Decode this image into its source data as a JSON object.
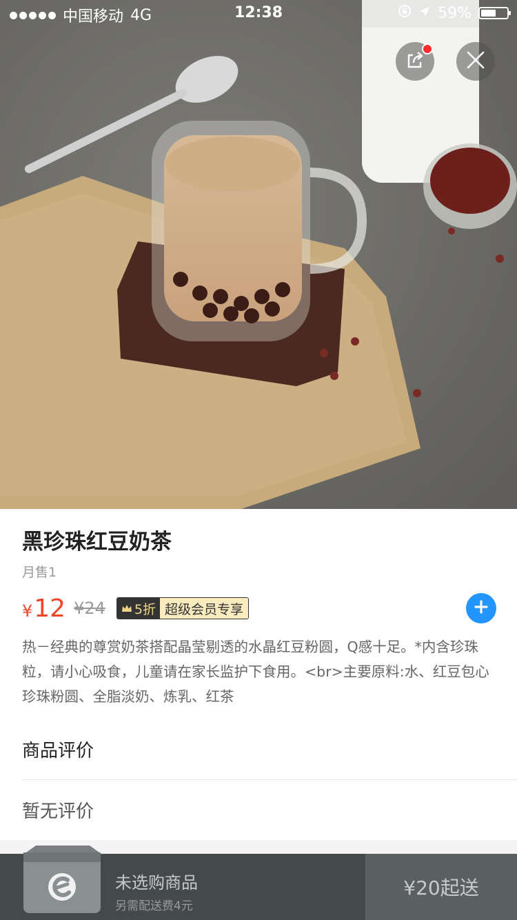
{
  "status_bar": {
    "carrier": "中国移动",
    "network": "4G",
    "time": "12:38",
    "battery": "59%",
    "battery_level": 0.59
  },
  "product": {
    "name": "黑珍珠红豆奶茶",
    "monthly_sales": "月售1",
    "currency": "¥",
    "price": "12",
    "original_price": "¥24",
    "discount": "5折",
    "member_label": "超级会员专享",
    "description": "热－经典的尊赏奶茶搭配晶莹剔透的水晶红豆粉圆，Q感十足。*内含珍珠粒，请小心吸食，儿童请在家长监护下食用。<br>主要原料:水、红豆包心珍珠粉圆、全脂淡奶、炼乳、红茶"
  },
  "reviews": {
    "title": "商品评价",
    "empty": "暂无评价"
  },
  "cart": {
    "status": "未选购商品",
    "delivery_fee": "另需配送费4元",
    "checkout": "¥20起送"
  },
  "colors": {
    "price": "#f2462b",
    "accent": "#2395ff",
    "cart_bar": "#444a4c"
  }
}
